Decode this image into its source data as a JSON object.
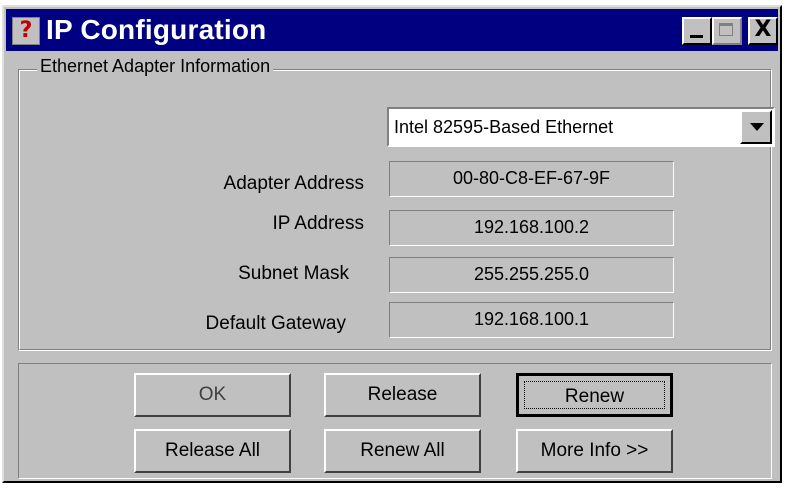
{
  "window": {
    "title": "IP Configuration",
    "icon": "ip-config-icon",
    "close_glyph": "X"
  },
  "group": {
    "label": "Ethernet  Adapter Information"
  },
  "adapter_select": {
    "value": "Intel 82595-Based Ethernet"
  },
  "fields": {
    "adapter_address": {
      "label": "Adapter Address",
      "value": "00-80-C8-EF-67-9F"
    },
    "ip_address": {
      "label": "IP Address",
      "value": "192.168.100.2"
    },
    "subnet_mask": {
      "label": "Subnet Mask",
      "value": "255.255.255.0"
    },
    "default_gateway": {
      "label": "Default Gateway",
      "value": "192.168.100.1"
    }
  },
  "buttons": {
    "ok": "OK",
    "release": "Release",
    "renew": "Renew",
    "release_all": "Release All",
    "renew_all": "Renew All",
    "more_info": "More Info >>"
  }
}
